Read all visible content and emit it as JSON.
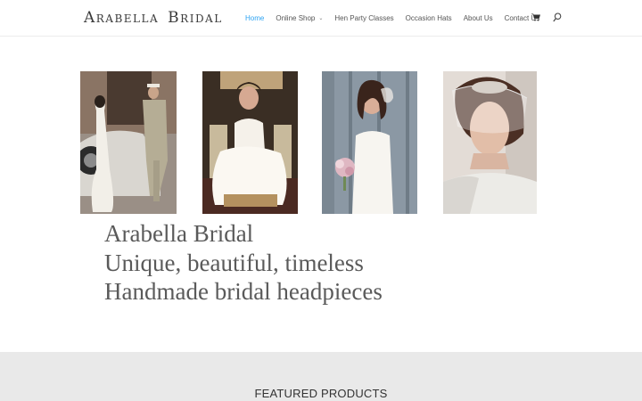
{
  "header": {
    "logo_text_1": "Arabella",
    "logo_text_2": "Bridal",
    "nav": [
      {
        "label": "Home",
        "active": true
      },
      {
        "label": "Online Shop",
        "has_dropdown": true
      },
      {
        "label": "Hen Party Classes"
      },
      {
        "label": "Occasion Hats"
      },
      {
        "label": "About Us"
      },
      {
        "label": "Contact Us"
      }
    ],
    "icons": [
      "cart-icon",
      "search-icon"
    ],
    "active_color": "#2ea3f2"
  },
  "gallery": {
    "images": [
      "vintage-car-bride-groom",
      "bride-seated-chair",
      "bride-with-bouquet-door",
      "bride-birdcage-veil-portrait"
    ]
  },
  "tagline": {
    "line1": "Arabella Bridal",
    "line2": "Unique, beautiful, timeless",
    "line3": "Handmade bridal headpieces"
  },
  "featured": {
    "title": "FEATURED PRODUCTS",
    "background": "#e9e9e9"
  }
}
